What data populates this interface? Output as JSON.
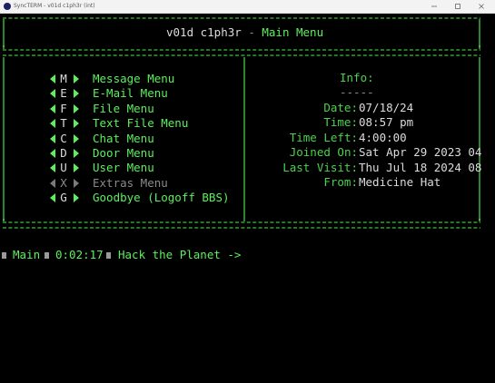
{
  "window": {
    "title": "SyncTERM - v01d c1ph3r (int)"
  },
  "header": {
    "bbs_name": "v01d c1ph3r",
    "separator": " - ",
    "menu_name": "Main Menu"
  },
  "menu": {
    "items": [
      {
        "key": "M",
        "label": "Message Menu",
        "enabled": true
      },
      {
        "key": "E",
        "label": "E-Mail Menu",
        "enabled": true
      },
      {
        "key": "F",
        "label": "File Menu",
        "enabled": true
      },
      {
        "key": "T",
        "label": "Text File Menu",
        "enabled": true
      },
      {
        "key": "C",
        "label": "Chat Menu",
        "enabled": true
      },
      {
        "key": "D",
        "label": "Door Menu",
        "enabled": true
      },
      {
        "key": "U",
        "label": "User Menu",
        "enabled": true
      },
      {
        "key": "X",
        "label": "Extras Menu",
        "enabled": false
      },
      {
        "key": "G",
        "label": "Goodbye (Logoff BBS)",
        "enabled": true
      }
    ]
  },
  "info": {
    "title": "Info:",
    "underline": "-----",
    "rows": [
      {
        "label": "Date:",
        "value": "07/18/24"
      },
      {
        "label": "Time:",
        "value": "08:57 pm"
      },
      {
        "label": "Time Left:",
        "value": "4:00:00"
      },
      {
        "label": "Joined On:",
        "value": "Sat Apr 29 2023 04"
      },
      {
        "label": "Last Visit:",
        "value": "Thu Jul 18 2024 08"
      },
      {
        "label": "From:",
        "value": "Medicine Hat"
      }
    ]
  },
  "prompt": {
    "location": "Main",
    "elapsed": "0:02:17",
    "text": "Hack the Planet ->"
  },
  "colors": {
    "accent": "#5cf05c",
    "border": "#3cc03c",
    "dim": "#8a8a8a",
    "background": "#000000"
  }
}
